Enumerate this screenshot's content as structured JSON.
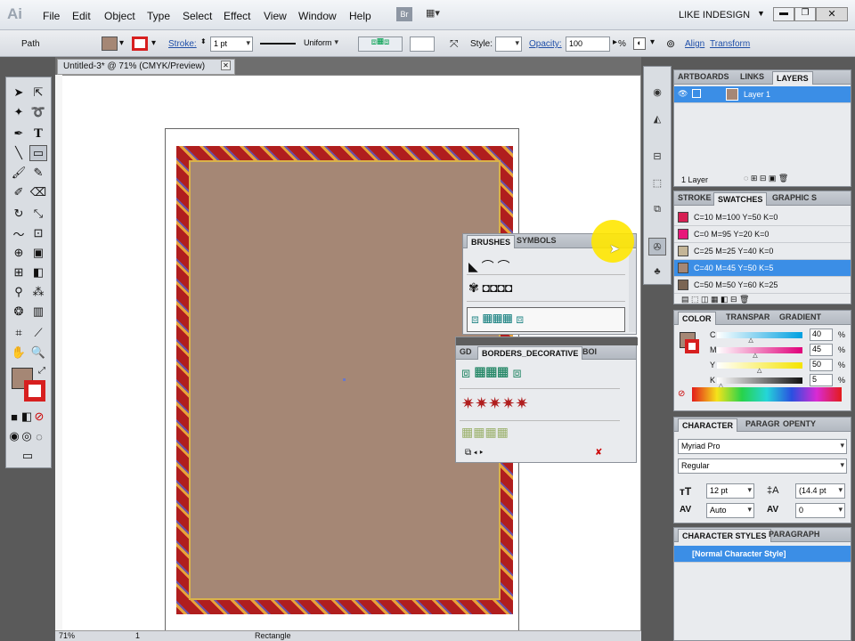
{
  "app": {
    "logo": "Ai",
    "workspace": "LIKE INDESIGN"
  },
  "menu": [
    "File",
    "Edit",
    "Object",
    "Type",
    "Select",
    "Effect",
    "View",
    "Window",
    "Help"
  ],
  "bridge_badge": "Br",
  "control": {
    "selection_type": "Path",
    "stroke_label": "Stroke:",
    "stroke_weight": "1 pt",
    "profile": "Uniform",
    "style_label": "Style:",
    "opacity_label": "Opacity:",
    "opacity_value": "100",
    "opacity_unit": "%",
    "align_label": "Align",
    "transform_label": "Transform"
  },
  "doc_tab": "Untitled-3* @ 71% (CMYK/Preview)",
  "status": {
    "zoom": "71%",
    "page": "1",
    "tool": "Rectangle"
  },
  "layers_panel": {
    "tabs": [
      "ARTBOARDS",
      "LINKS",
      "LAYERS"
    ],
    "layer_name": "Layer 1",
    "count": "1 Layer"
  },
  "swatches_panel": {
    "tabs": [
      "STROKE",
      "SWATCHES",
      "GRAPHIC S"
    ],
    "items": [
      {
        "label": "C=10 M=100 Y=50 K=0",
        "color": "#d71f53"
      },
      {
        "label": "C=0 M=95 Y=20 K=0",
        "color": "#e8177a"
      },
      {
        "label": "C=25 M=25 Y=40 K=0",
        "color": "#c4b597"
      },
      {
        "label": "C=40 M=45 Y=50 K=5",
        "color": "#a58775"
      },
      {
        "label": "C=50 M=50 Y=60 K=25",
        "color": "#7b6553"
      }
    ],
    "selected_index": 3
  },
  "brushes_panel": {
    "tabs": [
      "BRUSHES",
      "SYMBOLS"
    ]
  },
  "borders_panel": {
    "tabs": [
      "GD",
      "BORDERS_DECORATIVE",
      "BOI"
    ]
  },
  "color_panel": {
    "tabs": [
      "COLOR",
      "TRANSPAR",
      "GRADIENT"
    ],
    "channels": [
      {
        "name": "C",
        "value": "40",
        "pos": 0.4
      },
      {
        "name": "M",
        "value": "45",
        "pos": 0.45
      },
      {
        "name": "Y",
        "value": "50",
        "pos": 0.5
      },
      {
        "name": "K",
        "value": "5",
        "pos": 0.05
      }
    ],
    "unit": "%"
  },
  "character_panel": {
    "tabs": [
      "CHARACTER",
      "PARAGR",
      "OPENTY"
    ],
    "font_family": "Myriad Pro",
    "font_style": "Regular",
    "size": "12 pt",
    "leading": "(14.4 pt",
    "kerning": "Auto",
    "tracking": "0"
  },
  "char_styles_panel": {
    "tabs": [
      "CHARACTER STYLES",
      "PARAGRAPH"
    ],
    "item": "[Normal Character Style]"
  },
  "colors": {
    "fill": "#a58775",
    "stroke": "#d71f1f",
    "accent": "#3b8ee6"
  }
}
